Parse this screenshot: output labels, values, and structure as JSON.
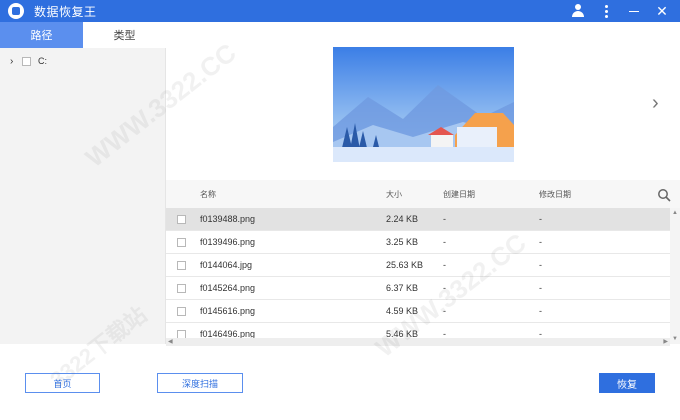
{
  "titlebar": {
    "title": "数据恢复王",
    "accent": "#2f6fdf"
  },
  "sidebar": {
    "tabs": [
      {
        "label": "路径",
        "active": true
      },
      {
        "label": "类型",
        "active": false
      }
    ],
    "tree": [
      {
        "label": "C:",
        "expand_icon": "chevron-right-icon"
      }
    ]
  },
  "preview": {
    "image": "landscape-preview",
    "next_icon": "chevron-right-icon"
  },
  "table": {
    "columns": [
      "名称",
      "大小",
      "创建日期",
      "修改日期"
    ],
    "rows": [
      {
        "name": "f0139488.png",
        "size": "2.24 KB",
        "created": "-",
        "modified": "-",
        "selected": true
      },
      {
        "name": "f0139496.png",
        "size": "3.25 KB",
        "created": "-",
        "modified": "-",
        "selected": false
      },
      {
        "name": "f0144064.jpg",
        "size": "25.63 KB",
        "created": "-",
        "modified": "-",
        "selected": false
      },
      {
        "name": "f0145264.png",
        "size": "6.37 KB",
        "created": "-",
        "modified": "-",
        "selected": false
      },
      {
        "name": "f0145616.png",
        "size": "4.59 KB",
        "created": "-",
        "modified": "-",
        "selected": false
      },
      {
        "name": "f0146496.png",
        "size": "5.46 KB",
        "created": "-",
        "modified": "-",
        "selected": false
      }
    ]
  },
  "footer": {
    "home_label": "首页",
    "deep_scan_label": "深度扫描",
    "restore_label": "恢复"
  },
  "watermark": {
    "text1": "WWW.3322.CC",
    "text2": "3322下载站"
  }
}
